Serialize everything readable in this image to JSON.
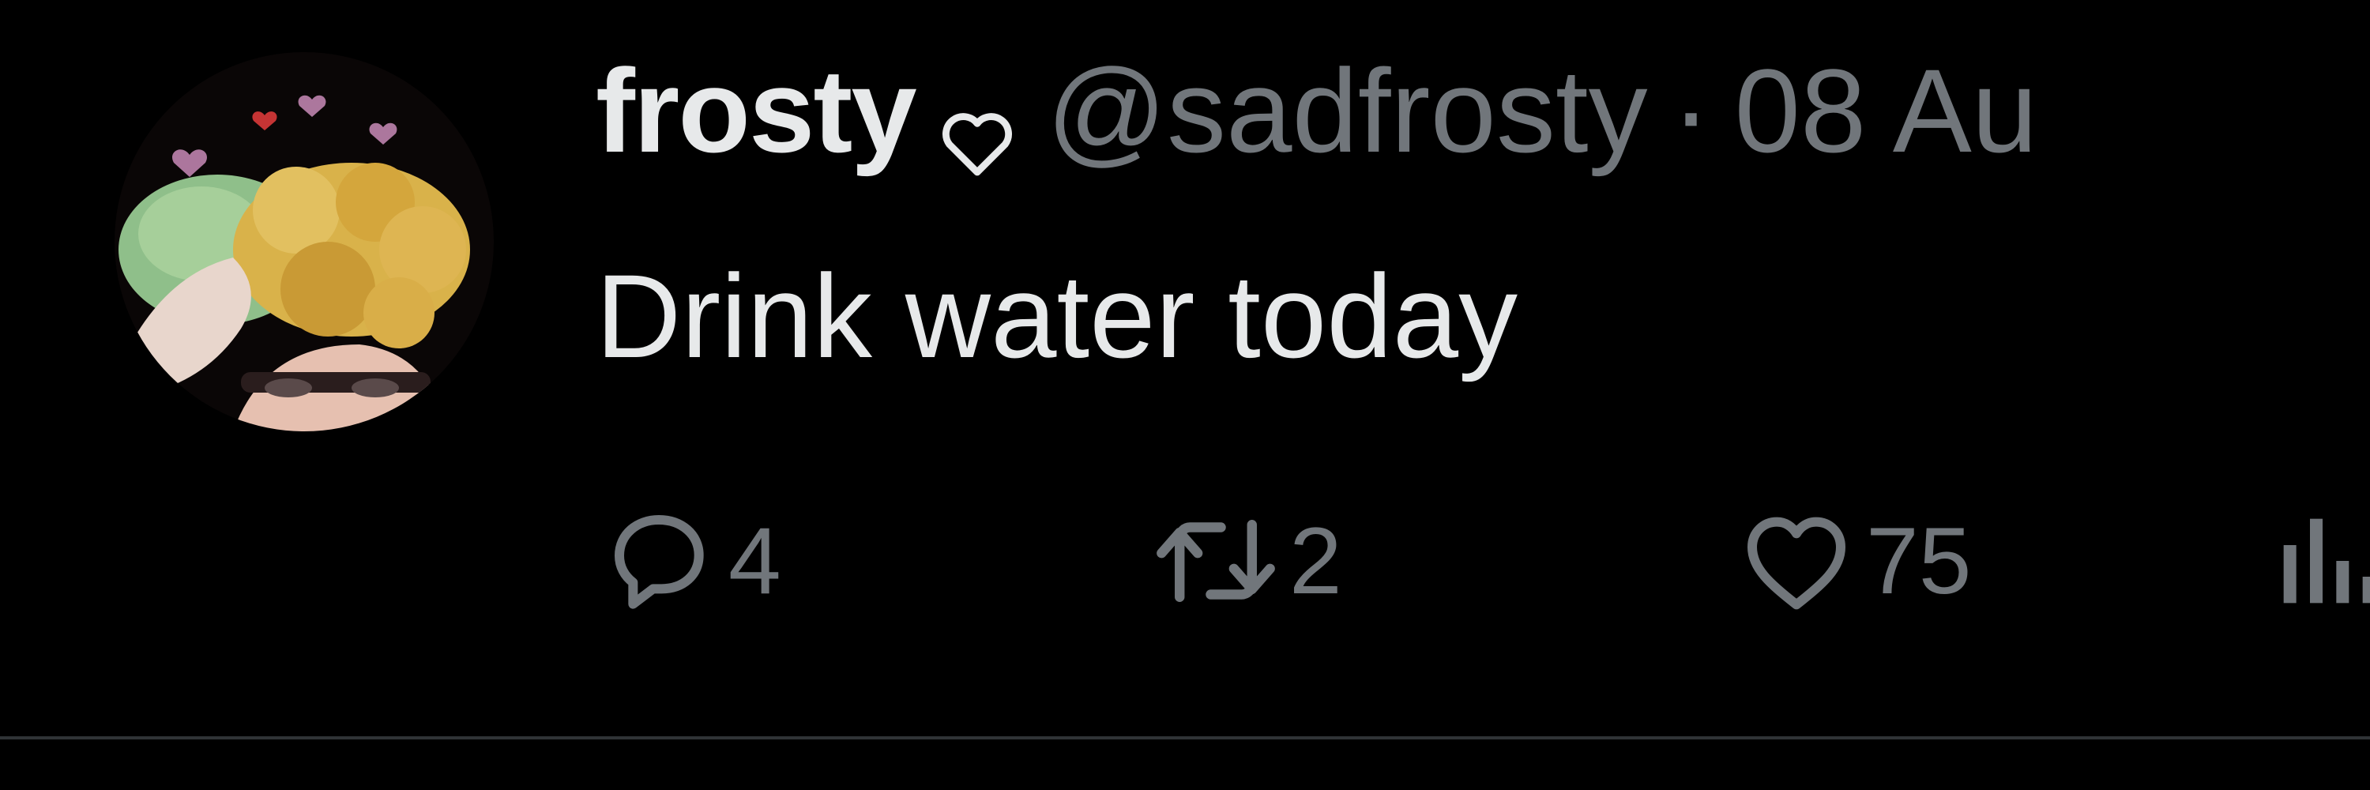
{
  "tweet": {
    "author": {
      "display_name": "frosty",
      "name_badge_icon": "heart-outline-icon",
      "handle": "@sadfrosty",
      "separator": "·",
      "date": "08 Au"
    },
    "text": "Drink water today",
    "actions": {
      "reply": {
        "icon": "reply-icon",
        "count": "4"
      },
      "retweet": {
        "icon": "retweet-icon",
        "count": "2"
      },
      "like": {
        "icon": "heart-icon",
        "count": "75"
      },
      "views": {
        "icon": "views-icon"
      }
    }
  },
  "colors": {
    "background": "#000000",
    "primary_text": "#e7e9ea",
    "secondary_text": "#71767b",
    "divider": "#2f3336"
  }
}
